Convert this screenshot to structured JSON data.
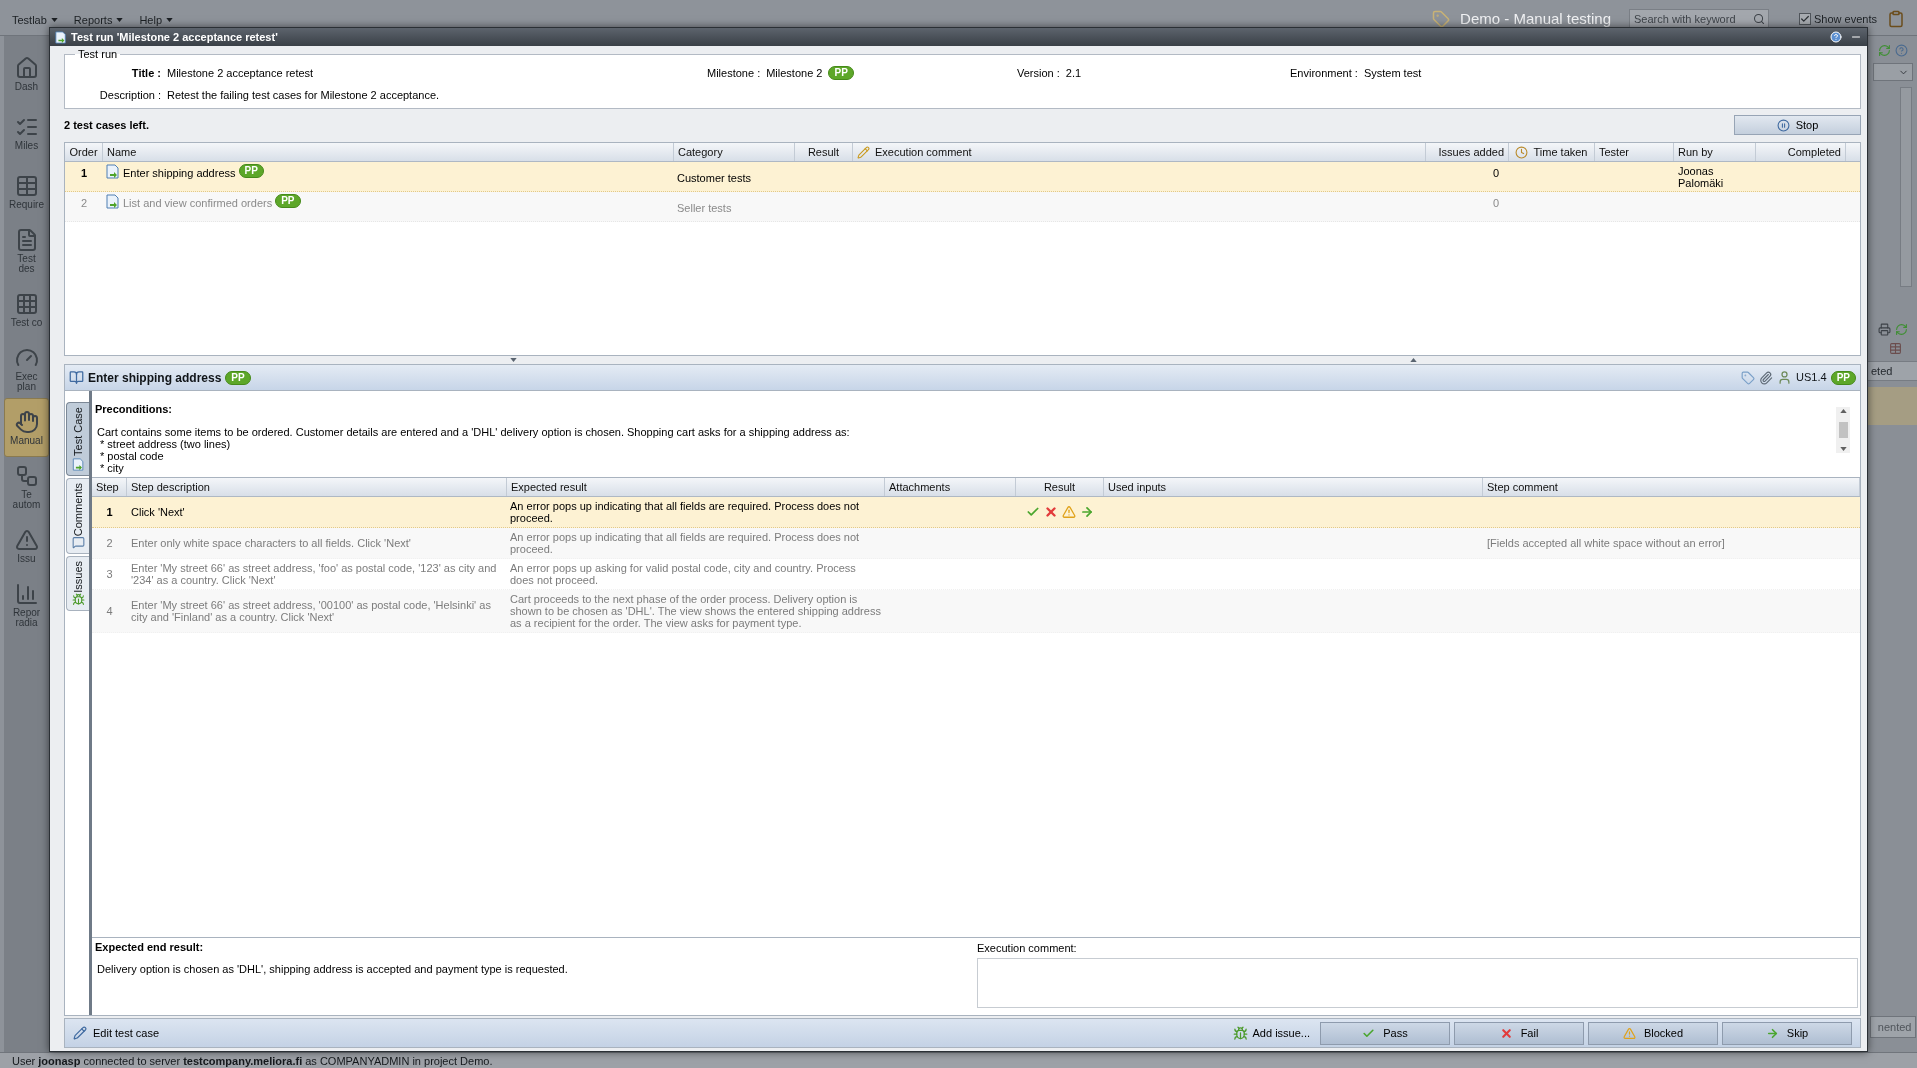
{
  "menu_bar": {
    "menus": [
      "Testlab",
      "Reports",
      "Help"
    ],
    "project": "Demo - Manual testing",
    "search": {
      "placeholder": "Search with keyword"
    },
    "show_events": {
      "label": "Show events",
      "checked": true
    }
  },
  "sidebar": {
    "items": [
      {
        "label": "Dash",
        "selected": false
      },
      {
        "label": "Miles",
        "selected": false
      },
      {
        "label": "Require",
        "selected": false
      },
      {
        "label": "Test des",
        "selected": false
      },
      {
        "label": "Test co",
        "selected": false
      },
      {
        "label": "Exec plan",
        "selected": false
      },
      {
        "label": "Manual",
        "selected": true
      },
      {
        "label": "Te autom",
        "selected": false
      },
      {
        "label": "Issu",
        "selected": false
      },
      {
        "label": "Repor radia",
        "selected": false
      }
    ]
  },
  "right_panel": {
    "column_header": "eted",
    "button": "nented"
  },
  "dialog": {
    "title": "Test run 'Milestone 2 acceptance retest'",
    "test_run": {
      "legend": "Test run",
      "fields": [
        {
          "label": "Title :",
          "value": "Milestone 2 acceptance retest"
        },
        {
          "label": "Milestone :",
          "value": "Milestone 2",
          "badge": "PP"
        },
        {
          "label": "Version :",
          "value": "2.1"
        },
        {
          "label": "Environment :",
          "value": "System test"
        }
      ],
      "description": {
        "label": "Description :",
        "value": "Retest the failing test cases for Milestone 2 acceptance."
      }
    },
    "cases_left": "2 test cases left.",
    "stop_button": "Stop",
    "test_cases": {
      "columns": [
        "Order",
        "Name",
        "Category",
        "Result",
        "Execution comment",
        "Issues added",
        "Time taken",
        "Tester",
        "Run by",
        "Completed"
      ],
      "rows": [
        {
          "order": "1",
          "name": "Enter shipping address",
          "badge": "PP",
          "category": "Customer tests",
          "issues_added": "0",
          "run_by": "Joonas Palomäki",
          "selected": true
        },
        {
          "order": "2",
          "name": "List and view confirmed orders",
          "badge": "PP",
          "category": "Seller tests",
          "issues_added": "0",
          "selected": false
        }
      ]
    },
    "test_case": {
      "title": "Enter shipping address",
      "badge": "PP",
      "reference": "US1.4",
      "reference_badge": "PP",
      "side_tabs": [
        {
          "label": "Test Case",
          "selected": true
        },
        {
          "label": "Comments",
          "selected": false
        },
        {
          "label": "Issues",
          "selected": false
        }
      ],
      "preconditions": {
        "heading": "Preconditions:",
        "text": "Cart contains some items to be ordered. Customer details are entered and a 'DHL' delivery option is chosen. Shopping cart asks for a shipping address as:",
        "items": [
          "* street address (two lines)",
          "* postal code",
          "* city"
        ]
      },
      "steps": {
        "columns": [
          "Step",
          "Step description",
          "Expected result",
          "Attachments",
          "Result",
          "Used inputs",
          "Step comment"
        ],
        "rows": [
          {
            "step": "1",
            "description": "Click 'Next'",
            "expected": "An error pops up indicating that all fields are required. Process does not proceed.",
            "selected": true
          },
          {
            "step": "2",
            "description": "Enter only white space characters to all fields. Click 'Next'",
            "expected": "An error pops up indicating that all fields are required. Process does not proceed.",
            "comment": "[Fields accepted all white space without an error]",
            "selected": false
          },
          {
            "step": "3",
            "description": "Enter 'My street 66' as street address, 'foo' as postal code, '123' as city and '234' as a country. Click 'Next'",
            "expected": "An error pops up asking for valid postal code, city and country. Process does not proceed.",
            "selected": false
          },
          {
            "step": "4",
            "description": "Enter 'My street 66' as street address, '00100' as postal code, 'Helsinki' as city and 'Finland' as a country. Click 'Next'",
            "expected": "Cart proceeds to the next phase of the order process. Delivery option is shown to be chosen as 'DHL'. The view shows the entered shipping address as a recipient for the order. The view asks for payment type.",
            "selected": false
          }
        ]
      },
      "expected_end_result": {
        "heading": "Expected end result:",
        "text": "Delivery option is chosen as 'DHL', shipping address is accepted and payment type is requested."
      },
      "execution_comment": {
        "label": "Execution comment:"
      }
    },
    "toolbar": {
      "edit_button": "Edit test case",
      "buttons": [
        {
          "kind": "add_issue",
          "label": "Add issue..."
        },
        {
          "kind": "pass",
          "label": "Pass"
        },
        {
          "kind": "fail",
          "label": "Fail"
        },
        {
          "kind": "blocked",
          "label": "Blocked"
        },
        {
          "kind": "skip",
          "label": "Skip"
        }
      ]
    }
  },
  "status_bar": "User **joonasp** connected to server **testcompany.meliora.fi** as COMPANYADMIN in project Demo."
}
